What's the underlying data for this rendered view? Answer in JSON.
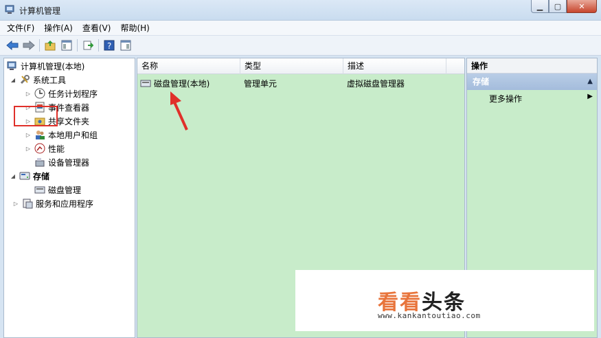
{
  "window": {
    "title": "计算机管理"
  },
  "menu": [
    {
      "label": "文件(F)"
    },
    {
      "label": "操作(A)"
    },
    {
      "label": "查看(V)"
    },
    {
      "label": "帮助(H)"
    }
  ],
  "tree": {
    "root": "计算机管理(本地)",
    "system_tools": "系统工具",
    "task_scheduler": "任务计划程序",
    "event_viewer": "事件查看器",
    "shared_folders": "共享文件夹",
    "local_users": "本地用户和组",
    "performance": "性能",
    "device_manager": "设备管理器",
    "storage": "存储",
    "disk_management": "磁盘管理",
    "services_apps": "服务和应用程序"
  },
  "list": {
    "columns": [
      "名称",
      "类型",
      "描述"
    ],
    "rows": [
      {
        "name": "磁盘管理(本地)",
        "type": "管理单元",
        "desc": "虚拟磁盘管理器"
      }
    ]
  },
  "actions": {
    "title": "操作",
    "section": "存储",
    "more": "更多操作"
  },
  "watermark": {
    "brand_a": "看看",
    "brand_b": "头条",
    "url": "www.kankantoutiao.com"
  },
  "colors": {
    "pane_green": "#c8ecca",
    "highlight_red": "#e0302a",
    "arrow_red": "#e0302a",
    "brand_orange": "#e8743b"
  }
}
